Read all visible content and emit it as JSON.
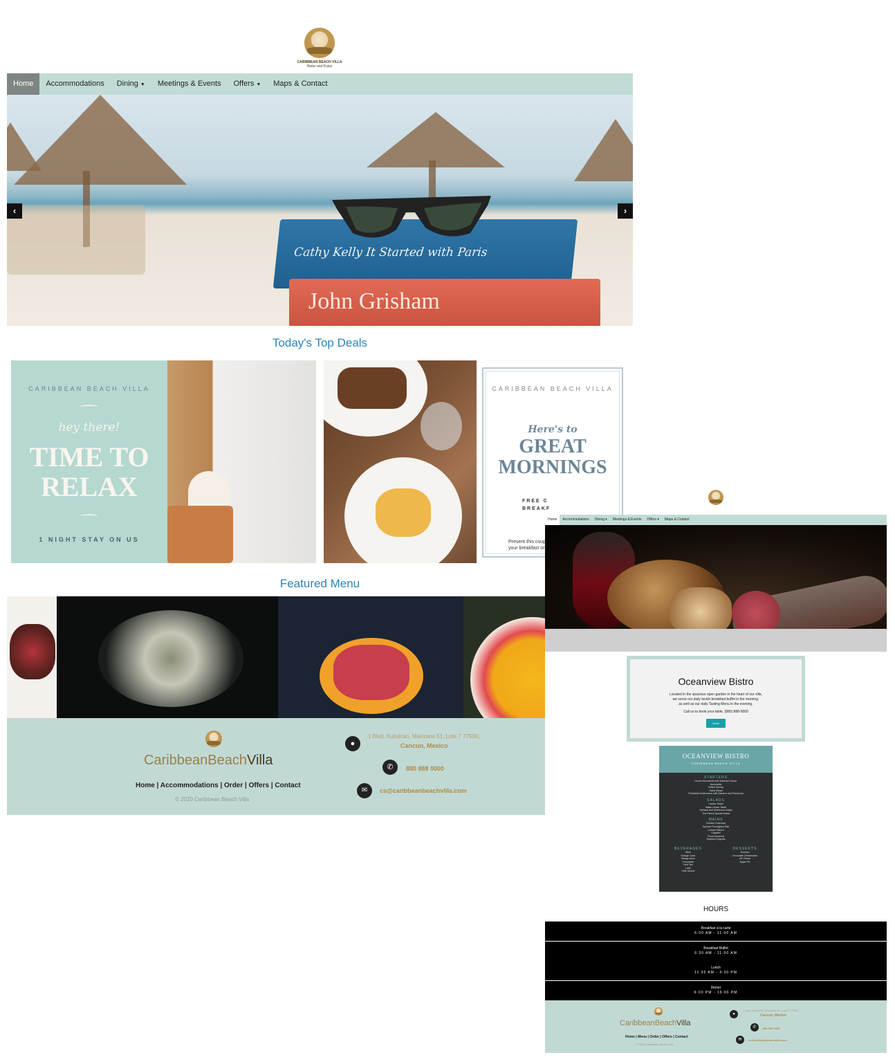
{
  "page1": {
    "logo": {
      "name": "CARIBBEAN BEACH VILLA",
      "tagline": "Relax and Enjoy"
    },
    "nav": [
      {
        "label": "Home",
        "active": true,
        "dropdown": false
      },
      {
        "label": "Accommodations",
        "active": false,
        "dropdown": false
      },
      {
        "label": "Dining",
        "active": false,
        "dropdown": true
      },
      {
        "label": "Meetings & Events",
        "active": false,
        "dropdown": false
      },
      {
        "label": "Offers",
        "active": false,
        "dropdown": true
      },
      {
        "label": "Maps & Contact",
        "active": false,
        "dropdown": false
      }
    ],
    "hero": {
      "prev_icon": "‹",
      "next_icon": "›",
      "book1": "Cathy Kelly  It Started with Paris",
      "book2": "John Grisham"
    },
    "deals_title": "Today's Top Deals",
    "deal1": {
      "brand": "CARIBBEAN BEACH VILLA",
      "hey": "hey there!",
      "line1": "TIME TO",
      "line2": "RELAX",
      "small": "1 NIGHT STAY ON US"
    },
    "deal3": {
      "brand": "CARIBBEAN BEACH VILLA",
      "here": "Here's to",
      "line1": "GREAT",
      "line2": "MORNINGS",
      "free1": "FREE C",
      "free2": "BREAKF",
      "present1": "Present this coupo",
      "present2": "your breakfast on"
    },
    "menu_title": "Featured Menu",
    "footer": {
      "brand_a": "CaribbeanBeach",
      "brand_b": "Villa",
      "links": "Home | Accommodations | Order | Offers | Contact",
      "copyright": "© 2020 Caribbean Beach Villa",
      "address1": "1 Blvd. Kukulcan, Manzana 51, Lote.7 77500,",
      "address2": "Cancun, Mexico",
      "phone": "880 888 0000",
      "email": "cs@caribbeanbeachvilla.com"
    }
  },
  "page2": {
    "nav": [
      {
        "label": "Home",
        "active": true
      },
      {
        "label": "Accommodations",
        "active": false
      },
      {
        "label": "Dining ▾",
        "active": false
      },
      {
        "label": "Meetings & Events",
        "active": false
      },
      {
        "label": "Offers ▾",
        "active": false
      },
      {
        "label": "Maps & Contact",
        "active": false
      }
    ],
    "bistro": {
      "title": "Oceanview Bistro",
      "body1": "Located in the spacious open garden in the heart of our villa,",
      "body2": "we serve our daily lavish breakfast buffet in the morning,",
      "body3": "as well as our daily Tasting Menu in the evening.",
      "call": "Call us to book your table, (880) 888-0000",
      "button": "Order"
    },
    "menu_card": {
      "title": "OCEANVIEW BISTRO",
      "subtitle": "CARIBBEAN BEACH VILLA",
      "sections": [
        {
          "heading": "STARTERS",
          "items": [
            "House Mozzarella with Marinara Sauce",
            "Bruschetta",
            "Grilled Shrimp",
            "Garlic Bread",
            "Portabella Mushrooms with Spinach and Parmesan"
          ]
        },
        {
          "heading": "SALADS",
          "items": [
            "Caesar Salad",
            "Italian House Salad",
            "Spinach and Mushroom Salad",
            "The Rivera Special Salad"
          ]
        },
        {
          "heading": "MAINS",
          "items": [
            "Chicken Scarmoid",
            "Spinach Parmigiana Bak",
            "Lobster Ravioli",
            "Capellini",
            "Pizza Suprema",
            "Seafood Linguine"
          ]
        }
      ],
      "beverages": {
        "heading": "BEVERAGES",
        "items": [
          "Wine",
          "Orange Juice",
          "Mango Juice",
          "Lemonade",
          "Iced Tea",
          "Latte",
          "Cafe Mocha"
        ]
      },
      "desserts": {
        "heading": "DESSERTS",
        "items": [
          "Tiramisu",
          "Chocolate Cheesecake",
          "Ice Cream",
          "Apple Pie"
        ]
      }
    },
    "hours_title": "HOURS",
    "hours": [
      {
        "name": "Breakfast à la carte",
        "time": "6:00 AM - 11:00 AM"
      },
      {
        "name": "Breakfast Buffet",
        "time": "6:30 AM - 11:00 AM"
      },
      {
        "name": "Lunch",
        "time": "11:30 AM - 4:30 PM"
      },
      {
        "name": "Dinner",
        "time": "6:00 PM - 10:00 PM"
      }
    ],
    "footer": {
      "brand_a": "CaribbeanBeach",
      "brand_b": "Villa",
      "links": "Home | Menu | Order | Offers | Contact",
      "copyright": "© 2020 Caribbean Beach Villa",
      "address1": "1 Blvd. Kukulcan, Manzana 51, Lote.7 77500,",
      "address2": "Cancun, Mexico",
      "phone": "880 888 0000",
      "email": "cs@caribbeanbeachvilla.com"
    }
  },
  "colors": {
    "teal": "#c1dcd6",
    "link_blue": "#2a83b6",
    "gold": "#b08a43",
    "button": "#16a0a8"
  },
  "icons": {
    "location": "map-marker-icon",
    "phone": "phone-icon",
    "email": "envelope-icon"
  }
}
